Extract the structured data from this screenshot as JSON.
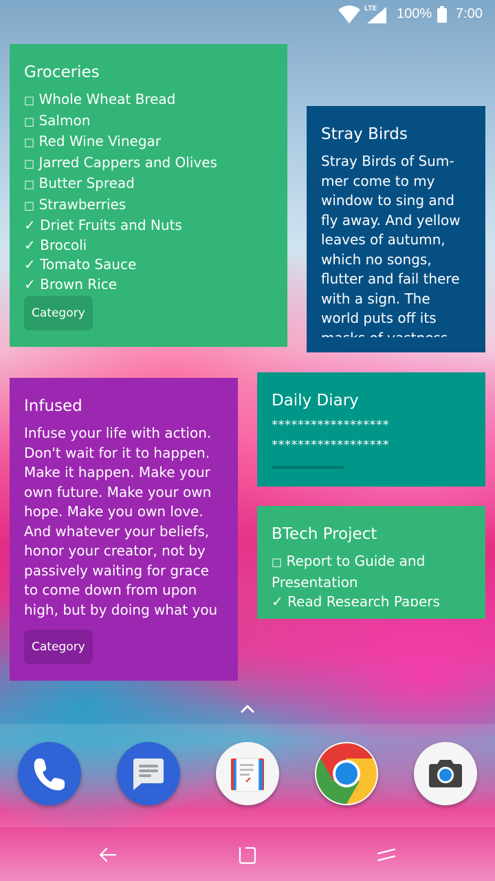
{
  "status_bar": {
    "network_label": "LTE",
    "battery_percent": "100%",
    "time": "7:00"
  },
  "notes": {
    "groceries": {
      "title": "Groceries",
      "items": [
        {
          "checked": false,
          "text": "Whole Wheat Bread"
        },
        {
          "checked": false,
          "text": "Salmon"
        },
        {
          "checked": false,
          "text": "Red Wine Vinegar"
        },
        {
          "checked": false,
          "text": "Jarred Cappers and Olives"
        },
        {
          "checked": false,
          "text": "Butter Spread"
        },
        {
          "checked": false,
          "text": "Strawberries"
        },
        {
          "checked": true,
          "text": "Driet Fruits and Nuts"
        },
        {
          "checked": true,
          "text": "Brocoli"
        },
        {
          "checked": true,
          "text": "Tomato Sauce"
        },
        {
          "checked": true,
          "text": "Brown Rice"
        }
      ],
      "category_label": "Category",
      "color": "#33b577"
    },
    "stray_birds": {
      "title": "Stray Birds",
      "body": "Stray Birds of Sum-\nmer come to my\nwindow to sing and\nfly away. And yellow\nleaves of autumn,\nwhich no songs,\nflutter and fail there\nwith a sign. The\nworld puts off its\nmasks of vastness",
      "color": "#064f83"
    },
    "infused": {
      "title": "Infused",
      "body": "Infuse your life with action.\nDon't wait for it to happen.\nMake it happen. Make your\nown future. Make your own\nhope. Make you own love.\nAnd whatever your beliefs,\nhonor your creator, not by\npassively waiting for grace\nto come down from upon\nhigh, but by doing what you",
      "category_label": "Category",
      "color": "#9c27b0"
    },
    "daily_diary": {
      "title": "Daily Diary",
      "body": "******************\n******************",
      "color": "#009688"
    },
    "btech_project": {
      "title": "BTech Project",
      "items": [
        {
          "checked": false,
          "text": "Report to Guide and Presentation"
        },
        {
          "checked": true,
          "text": "Read Research Papers"
        }
      ],
      "color": "#33b577"
    }
  },
  "checkbox_symbols": {
    "unchecked": "□",
    "checked": "✓"
  },
  "dock": {
    "apps": [
      {
        "id": "phone",
        "icon": "phone-icon"
      },
      {
        "id": "messages",
        "icon": "messages-icon"
      },
      {
        "id": "notes",
        "icon": "notes-icon"
      },
      {
        "id": "chrome",
        "icon": "chrome-icon"
      },
      {
        "id": "camera",
        "icon": "camera-icon"
      }
    ]
  },
  "nav_bar": {
    "buttons": [
      "back-icon",
      "home-icon",
      "recents-icon"
    ]
  }
}
